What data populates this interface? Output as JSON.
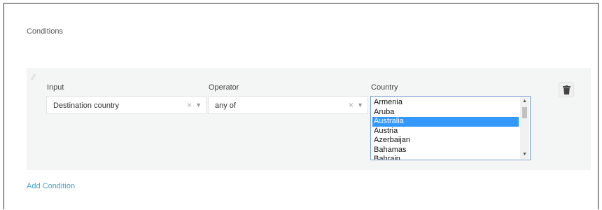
{
  "section": {
    "title": "Conditions"
  },
  "condition": {
    "input": {
      "label": "Input",
      "value": "Destination country",
      "clear_glyph": "×",
      "caret_glyph": "▼"
    },
    "operator": {
      "label": "Operator",
      "value": "any of",
      "clear_glyph": "×",
      "caret_glyph": "▼"
    },
    "country": {
      "label": "Country",
      "options": [
        "Armenia",
        "Aruba",
        "Australia",
        "Austria",
        "Azerbaijan",
        "Bahamas",
        "Bahrain"
      ],
      "selected": "Australia"
    },
    "delete_icon": "trash-icon",
    "drag_icon": "drag-handle-icon"
  },
  "actions": {
    "add_condition": "Add Condition"
  },
  "colors": {
    "accent_link": "#4aa3c7",
    "selected_option": "#3399ff",
    "block_bg": "#f4f5f5"
  }
}
